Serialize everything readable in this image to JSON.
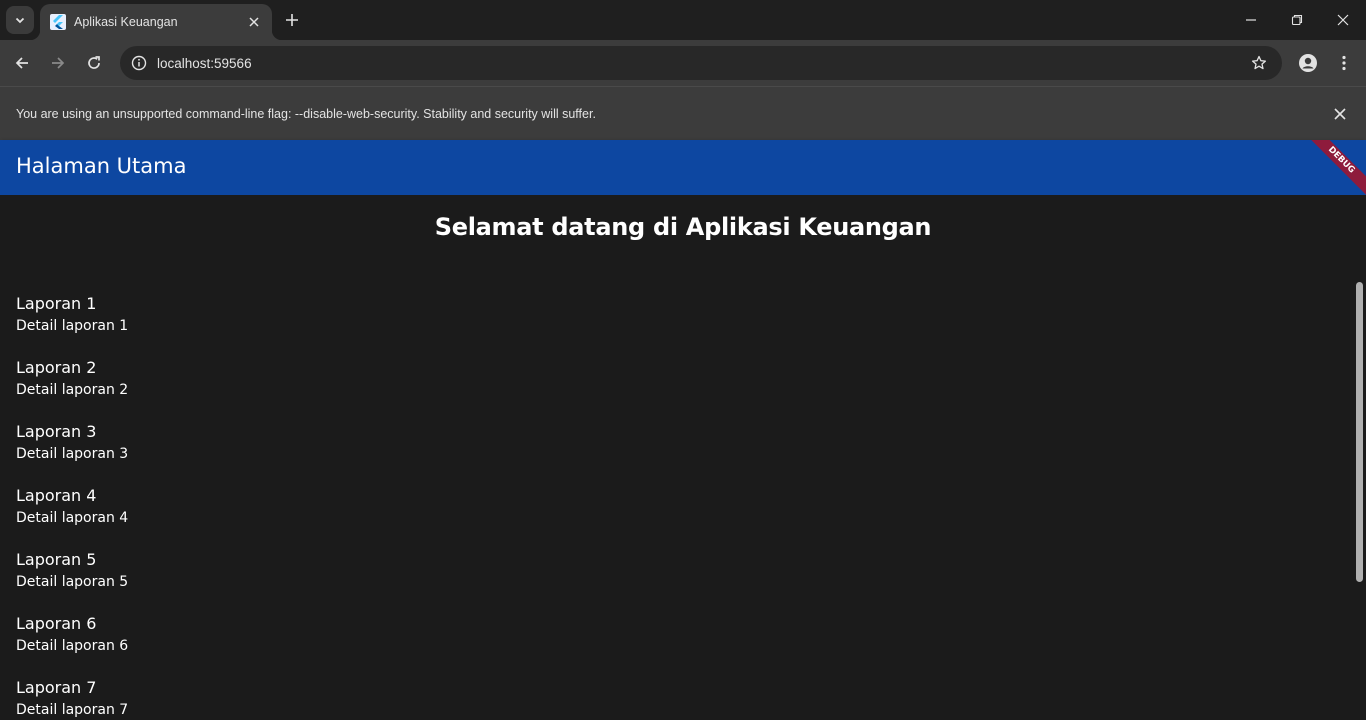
{
  "browser": {
    "tab_title": "Aplikasi Keuangan",
    "url": "localhost:59566",
    "infobar_message": "You are using an unsupported command-line flag: --disable-web-security. Stability and security will suffer."
  },
  "app": {
    "appbar_title": "Halaman Utama",
    "debug_banner": "DEBUG",
    "welcome": "Selamat datang di Aplikasi Keuangan",
    "reports": [
      {
        "title": "Laporan 1",
        "detail": "Detail laporan 1"
      },
      {
        "title": "Laporan 2",
        "detail": "Detail laporan 2"
      },
      {
        "title": "Laporan 3",
        "detail": "Detail laporan 3"
      },
      {
        "title": "Laporan 4",
        "detail": "Detail laporan 4"
      },
      {
        "title": "Laporan 5",
        "detail": "Detail laporan 5"
      },
      {
        "title": "Laporan 6",
        "detail": "Detail laporan 6"
      },
      {
        "title": "Laporan 7",
        "detail": "Detail laporan 7"
      }
    ]
  },
  "colors": {
    "appbar": "#0d47a1",
    "background": "#1b1b1b",
    "debug_banner": "#8e1b3c"
  },
  "icons": [
    "tab-search-icon",
    "flutter-favicon-icon",
    "close-icon",
    "plus-icon",
    "minimize-icon",
    "restore-icon",
    "back-icon",
    "forward-icon",
    "reload-icon",
    "info-icon",
    "star-icon",
    "profile-icon",
    "menu-icon"
  ]
}
